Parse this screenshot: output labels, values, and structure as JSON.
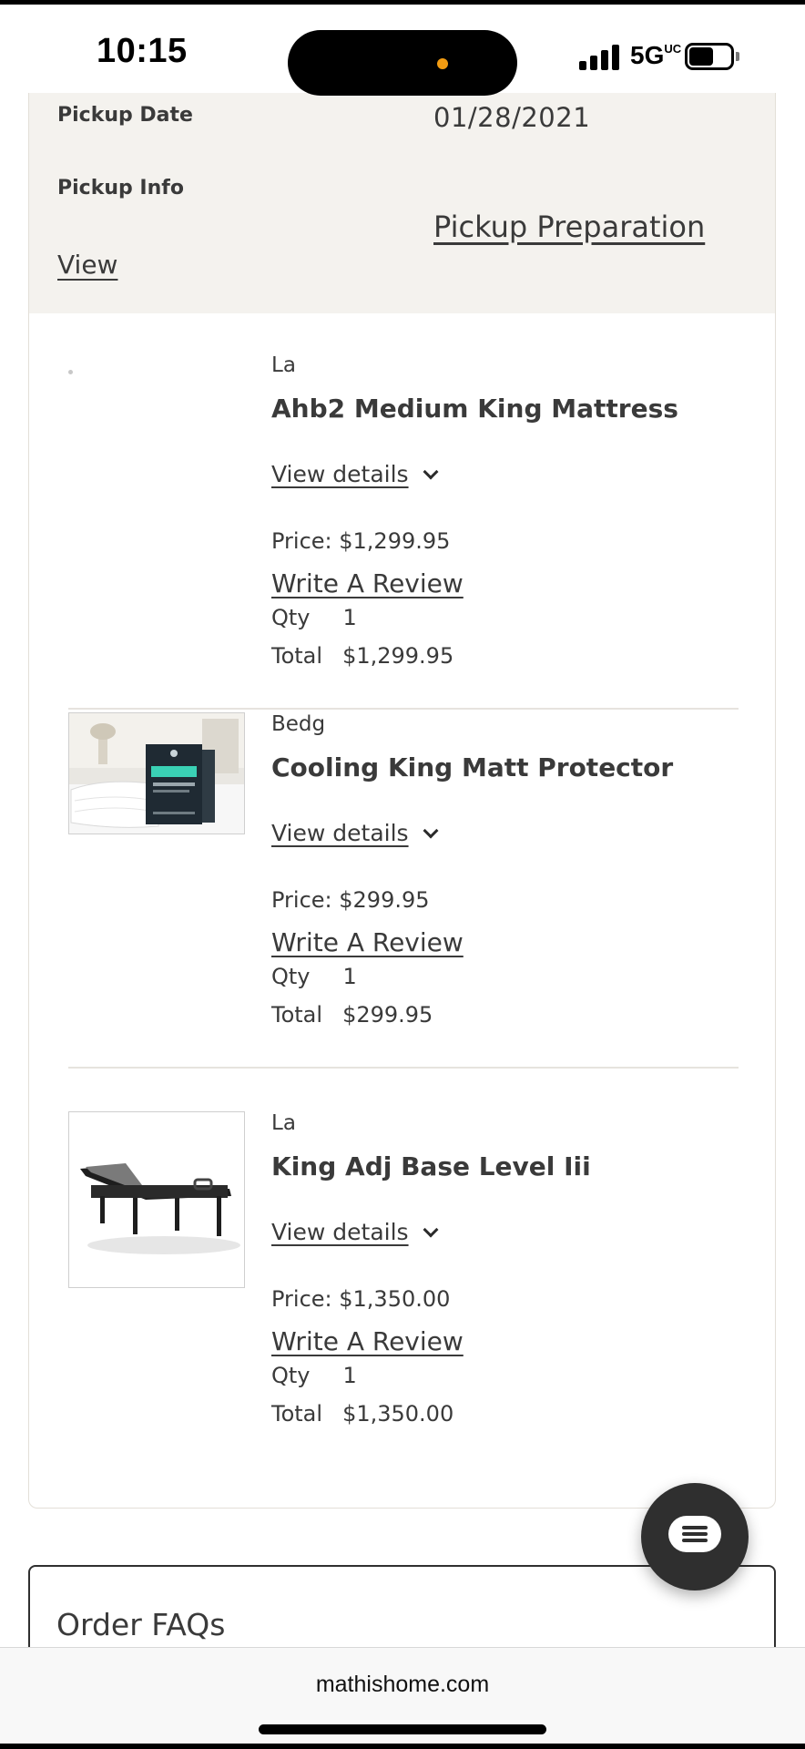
{
  "status_bar": {
    "time": "10:15",
    "network": "5G",
    "network_sub": "UC",
    "battery_level": 0.6
  },
  "pickup": {
    "date_label": "Pickup Date",
    "date_value": "01/28/2021",
    "info_label": "Pickup Info",
    "preparation_link": "Pickup Preparation",
    "view_link": "View"
  },
  "items": [
    {
      "brand": "La",
      "name": "Ahb2 Medium King Mattress",
      "details_label": "View details",
      "price": "Price: $1,299.95",
      "review_label": "Write A Review",
      "qty_label": "Qty",
      "qty_value": "1",
      "total_label": "Total",
      "total_value": "$1,299.95",
      "image": "none"
    },
    {
      "brand": "Bedg",
      "name": "Cooling King Matt Protector",
      "details_label": "View details",
      "price": "Price: $299.95",
      "review_label": "Write A Review",
      "qty_label": "Qty",
      "qty_value": "1",
      "total_label": "Total",
      "total_value": "$299.95",
      "image": "mattress-protector-photo"
    },
    {
      "brand": "La",
      "name": "King Adj Base Level Iii",
      "details_label": "View details",
      "price": "Price: $1,350.00",
      "review_label": "Write A Review",
      "qty_label": "Qty",
      "qty_value": "1",
      "total_label": "Total",
      "total_value": "$1,350.00",
      "image": "adjustable-base-photo"
    }
  ],
  "faq": {
    "title": "Order FAQs"
  },
  "browser": {
    "url": "mathishome.com"
  },
  "colors": {
    "panel_bg": "#f4f2ee",
    "text": "#3a3a3a",
    "chat_button": "#2f2f2f"
  },
  "icons": [
    "chevron-down-icon",
    "chat-icon",
    "signal-icon",
    "battery-icon"
  ]
}
